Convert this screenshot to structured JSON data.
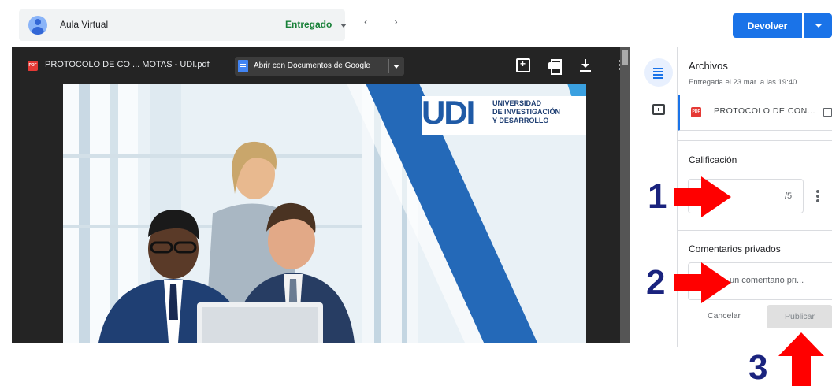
{
  "topbar": {
    "student_name": "Aula Virtual",
    "status": "Entregado",
    "return_label": "Devolver",
    "prev_icon": "chevron-left-icon",
    "next_icon": "chevron-right-icon"
  },
  "viewer": {
    "file_name": "PROTOCOLO DE CO ... MOTAS - UDI.pdf",
    "pdf_badge": "PDF",
    "open_with_label": "Abrir con Documentos de Google",
    "icons": [
      "comment-add-icon",
      "print-icon",
      "download-icon",
      "more-vert-icon"
    ]
  },
  "page": {
    "logo_text": "UDI",
    "institution_line1": "UNIVERSIDAD",
    "institution_line2": "DE INVESTIGACIÓN",
    "institution_line3": "Y DESARROLLO"
  },
  "panel": {
    "files_title": "Archivos",
    "files_subtitle": "Entregada el 23 mar. a las 19:40",
    "attachment_name": "PROTOCOLO DE CON...",
    "attachment_badge": "PDF",
    "grade_title": "Calificación",
    "grade_suffix": "/5",
    "comments_title": "Comentarios privados",
    "comment_placeholder": "un comentario pri...",
    "cancel_label": "Cancelar",
    "publish_label": "Publicar"
  },
  "annotations": {
    "step1": "1",
    "step2": "2",
    "step3": "3",
    "arrow_color": "#ff0000",
    "number_color": "#1a237e"
  },
  "colors": {
    "accent": "#1a73e8",
    "status": "#188038",
    "viewer_bg": "#242424"
  }
}
